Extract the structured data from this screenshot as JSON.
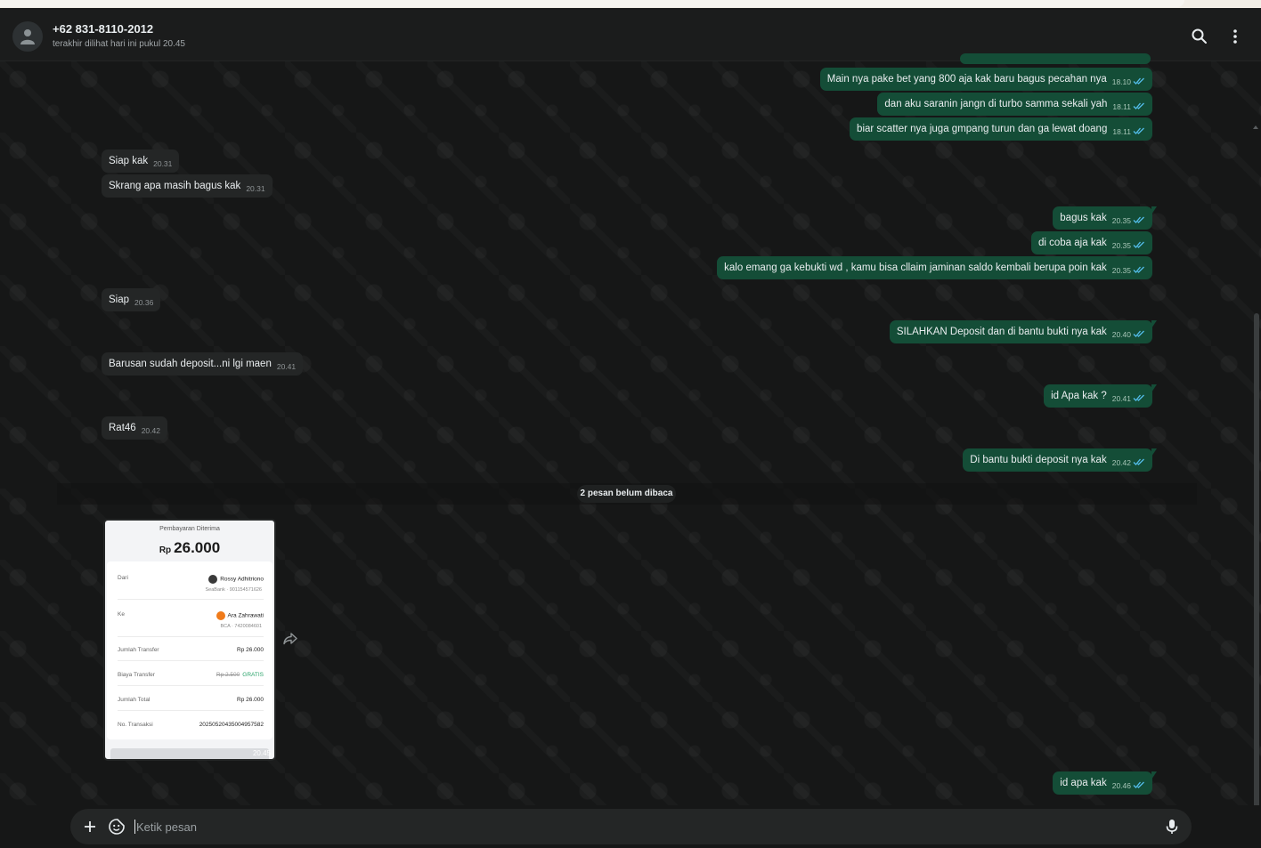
{
  "header": {
    "contact_name": "+62 831-8110-2012",
    "contact_status": "terakhir dilihat hari ini pukul 20.45"
  },
  "messages": [
    {
      "dir": "out",
      "text": "Main nya pake bet yang 800 aja kak baru bagus pecahan nya",
      "time": "18.10"
    },
    {
      "dir": "out",
      "text": "dan aku saranin jangn di turbo samma sekali yah",
      "time": "18.11"
    },
    {
      "dir": "out",
      "text": "biar scatter nya juga gmpang turun dan ga lewat doang",
      "time": "18.11"
    },
    {
      "dir": "in",
      "text": "Siap kak",
      "time": "20.31"
    },
    {
      "dir": "in",
      "text": "Skrang apa masih bagus kak",
      "time": "20.31"
    },
    {
      "dir": "out",
      "text": "bagus kak",
      "time": "20.35"
    },
    {
      "dir": "out",
      "text": "di coba aja kak",
      "time": "20.35"
    },
    {
      "dir": "out",
      "text": "kalo emang ga kebukti wd , kamu bisa cllaim jaminan saldo kembali berupa poin kak",
      "time": "20.35"
    },
    {
      "dir": "in",
      "text": "Siap",
      "time": "20.36"
    },
    {
      "dir": "out",
      "text": "SILAHKAN Deposit dan di bantu bukti nya kak",
      "time": "20.40"
    },
    {
      "dir": "in",
      "text": "Barusan sudah deposit...ni lgi maen",
      "time": "20.41"
    },
    {
      "dir": "out",
      "text": "id Apa kak ?",
      "time": "20.41"
    },
    {
      "dir": "in",
      "text": "Rat46",
      "time": "20.42"
    },
    {
      "dir": "out",
      "text": "Di bantu bukti deposit nya kak",
      "time": "20.42"
    },
    {
      "dir": "out",
      "text": "id apa kak",
      "time": "20.46"
    }
  ],
  "unread_divider": "2 pesan belum dibaca",
  "receipt": {
    "title": "Pembayaran Diterima",
    "currency": "Rp",
    "amount": "26.000",
    "from_label": "Dari",
    "from_name": "Rossy Adhitriono",
    "from_account": "SeaBank · 901154571626",
    "to_label": "Ke",
    "to_name": "Ara Zahrawati",
    "to_account": "BCA · 7420084601",
    "transfer_label": "Jumlah Transfer",
    "transfer_value": "Rp 26.000",
    "fee_label": "Biaya Transfer",
    "fee_original": "Rp 2.500",
    "fee_value": "GRATIS",
    "total_label": "Jumlah Total",
    "total_value": "Rp 26.000",
    "txn_label": "No. Transaksi",
    "txn_value": "20250520435004957582",
    "time": "20.45"
  },
  "composer": {
    "placeholder": "Ketik pesan"
  },
  "colors": {
    "outgoing_bubble": "#144d37",
    "incoming_bubble": "#242626",
    "read_ticks": "#53bdeb",
    "background": "#161717"
  },
  "icons": {
    "search": "search-icon",
    "menu": "more-vertical-icon",
    "attach": "plus-icon",
    "sticker": "sticker-icon",
    "mic": "microphone-icon",
    "forward": "forward-icon",
    "read": "double-check-icon"
  }
}
